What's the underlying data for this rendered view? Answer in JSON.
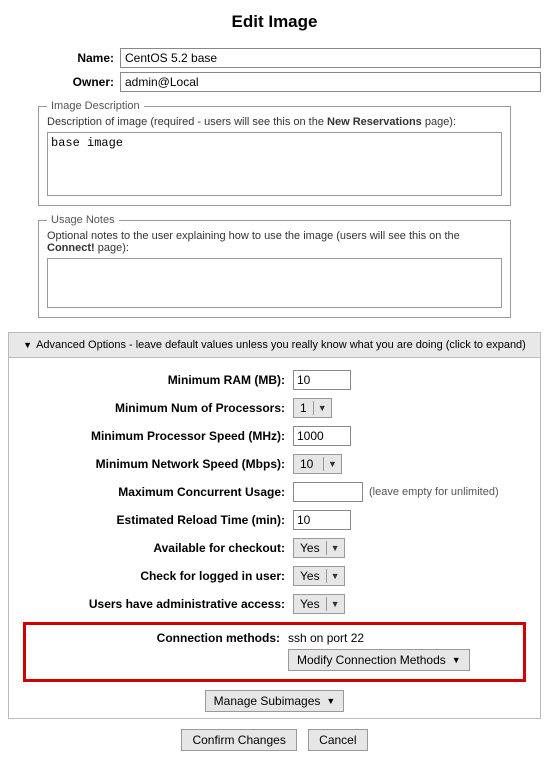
{
  "title": "Edit Image",
  "labels": {
    "name": "Name:",
    "owner": "Owner:"
  },
  "values": {
    "name": "CentOS 5.2 base",
    "owner": "admin@Local"
  },
  "image_description": {
    "legend": "Image Description",
    "help_pre": "Description of image (required - users will see this on the ",
    "help_bold": "New Reservations",
    "help_post": " page):",
    "value": "base image"
  },
  "usage_notes": {
    "legend": "Usage Notes",
    "help_pre": "Optional notes to the user explaining how to use the image (users will see this on the ",
    "help_bold": "Connect!",
    "help_post": " page):",
    "value": ""
  },
  "advanced": {
    "header": "Advanced Options - leave default values unless you really know what you are doing (click to expand)",
    "options": {
      "min_ram": {
        "label": "Minimum RAM (MB):",
        "value": "10"
      },
      "min_procs": {
        "label": "Minimum Num of Processors:",
        "value": "1"
      },
      "min_proc_speed": {
        "label": "Minimum Processor Speed (MHz):",
        "value": "1000"
      },
      "min_net_speed": {
        "label": "Minimum Network Speed (Mbps):",
        "value": "10"
      },
      "max_concurrent": {
        "label": "Maximum Concurrent Usage:",
        "value": "",
        "hint": "(leave empty for unlimited)"
      },
      "reload_time": {
        "label": "Estimated Reload Time (min):",
        "value": "10"
      },
      "available_checkout": {
        "label": "Available for checkout:",
        "value": "Yes"
      },
      "check_logged_in": {
        "label": "Check for logged in user:",
        "value": "Yes"
      },
      "admin_access": {
        "label": "Users have administrative access:",
        "value": "Yes"
      },
      "connection_methods": {
        "label": "Connection methods:",
        "value": "ssh on port 22",
        "button": "Modify Connection Methods"
      }
    },
    "manage_subimages": "Manage Subimages"
  },
  "buttons": {
    "confirm": "Confirm Changes",
    "cancel": "Cancel"
  }
}
